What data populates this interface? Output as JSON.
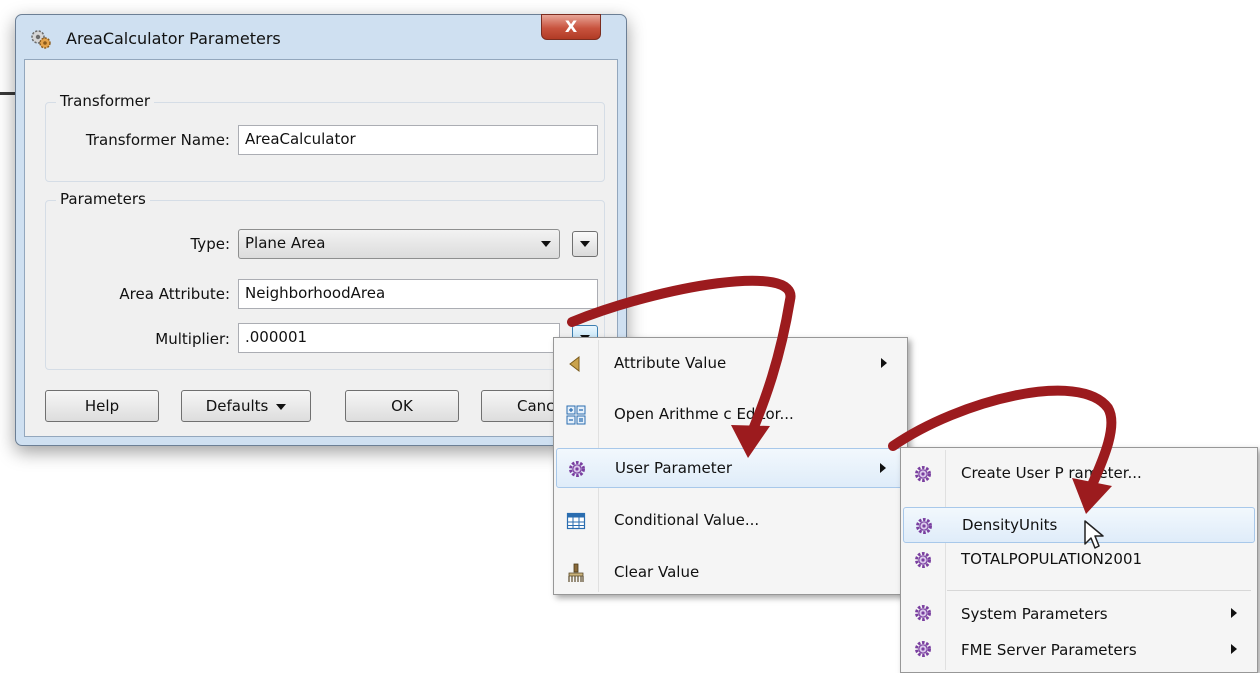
{
  "dialog": {
    "title": "AreaCalculator Parameters",
    "close_label": "X",
    "transformer_group": {
      "title": "Transformer",
      "name_label": "Transformer Name:",
      "name_value": "AreaCalculator"
    },
    "parameters_group": {
      "title": "Parameters",
      "type_label": "Type:",
      "type_value": "Plane Area",
      "area_attr_label": "Area Attribute:",
      "area_attr_value": "NeighborhoodArea",
      "multiplier_label": "Multiplier:",
      "multiplier_value": ".000001"
    },
    "buttons": {
      "help": "Help",
      "defaults": "Defaults",
      "ok": "OK",
      "cancel": "Canc"
    }
  },
  "menu1": {
    "items": [
      {
        "label": "Attribute Value",
        "icon": "attribute-value-icon",
        "submenu": true
      },
      {
        "label": "Open Arithme  c Editor...",
        "icon": "arithmetic-editor-icon",
        "submenu": false
      },
      {
        "label": "User Parameter",
        "icon": "user-parameter-icon",
        "submenu": true,
        "highlighted": true
      },
      {
        "label": "Conditional Value...",
        "icon": "conditional-table-icon",
        "submenu": false
      },
      {
        "label": "Clear Value",
        "icon": "clear-brush-icon",
        "submenu": false
      }
    ]
  },
  "menu2": {
    "items": [
      {
        "label": "Create User P  rameter...",
        "icon": "gear-icon"
      },
      {
        "label": "DensityUnits",
        "icon": "gear-icon",
        "highlighted": true
      },
      {
        "label": "TOTALPOPULATION2001",
        "icon": "gear-icon"
      },
      {
        "label": "System Parameters",
        "icon": "gear-icon",
        "submenu": true
      },
      {
        "label": "FME Server Parameters",
        "icon": "gear-icon",
        "submenu": true
      }
    ]
  },
  "colors": {
    "arrow": "#9c1b1e",
    "window_frame": "#cfe0f1",
    "close_button": "#c8533e",
    "menu_highlight": "#dfecf9"
  }
}
